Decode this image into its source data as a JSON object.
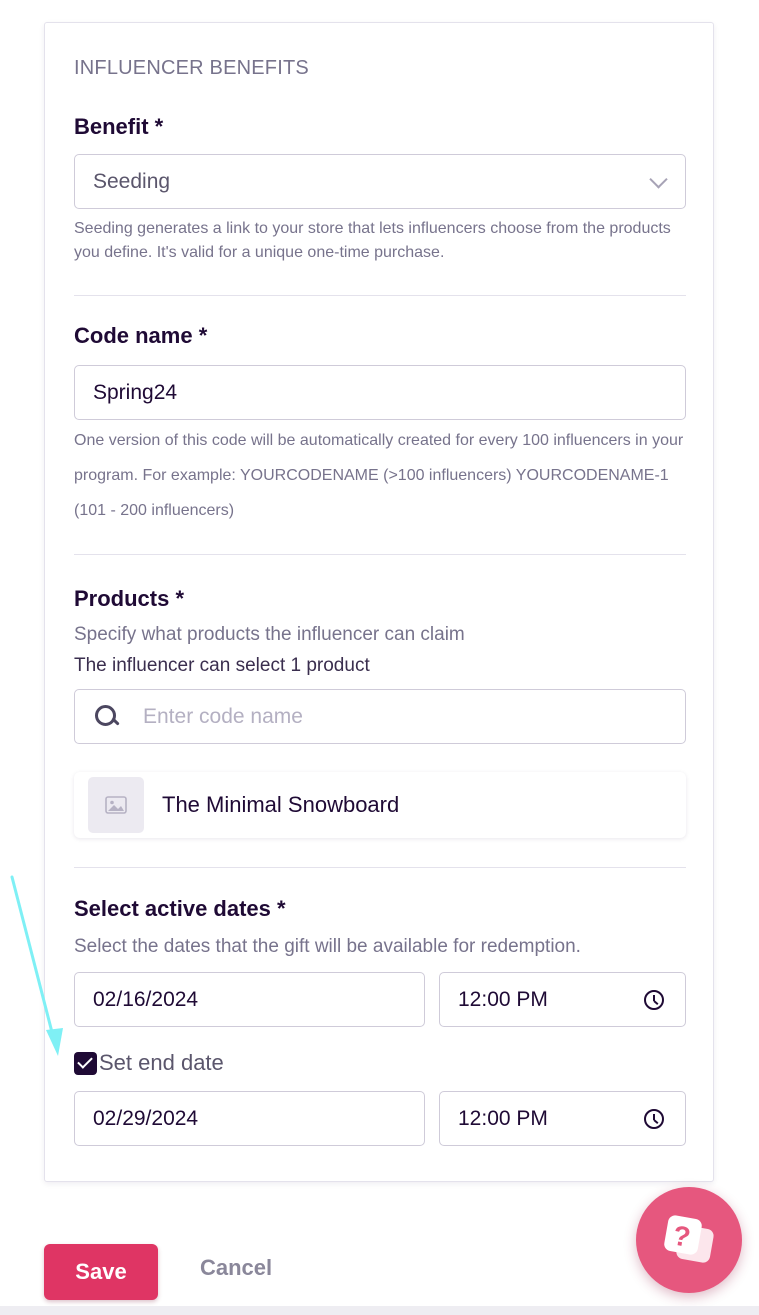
{
  "section": {
    "title": "INFLUENCER BENEFITS"
  },
  "benefit": {
    "label": "Benefit *",
    "selected": "Seeding",
    "help": "Seeding generates a link to your store that lets influencers choose from the products you define. It's valid for a unique one-time purchase."
  },
  "code_name": {
    "label": "Code name *",
    "value": "Spring24",
    "help": "One version of this code will be automatically created for every 100 influencers in your program. For example: YOURCODENAME (>100 influencers) YOURCODENAME-1 (101 - 200 influencers)"
  },
  "products": {
    "label": "Products *",
    "subtitle": "Specify what products the influencer can claim",
    "limit_text": "The influencer can select 1 product",
    "search_placeholder": "Enter code name",
    "items": [
      {
        "name": "The Minimal Snowboard",
        "icon": "image-placeholder-icon"
      }
    ]
  },
  "dates": {
    "label": "Select active dates *",
    "subtitle": "Select the dates that the gift will be available for redemption.",
    "start_date": "02/16/2024",
    "start_time": "12:00 PM",
    "end_date_checkbox_label": "Set end date",
    "end_date_checked": true,
    "end_date": "02/29/2024",
    "end_time": "12:00 PM"
  },
  "actions": {
    "save_label": "Save",
    "cancel_label": "Cancel"
  },
  "colors": {
    "primary": "#df3564",
    "help_fab": "#e6577e",
    "text_dark": "#1f0a35",
    "text_muted": "#77738c",
    "annotation_arrow": "#7ff0f5"
  }
}
